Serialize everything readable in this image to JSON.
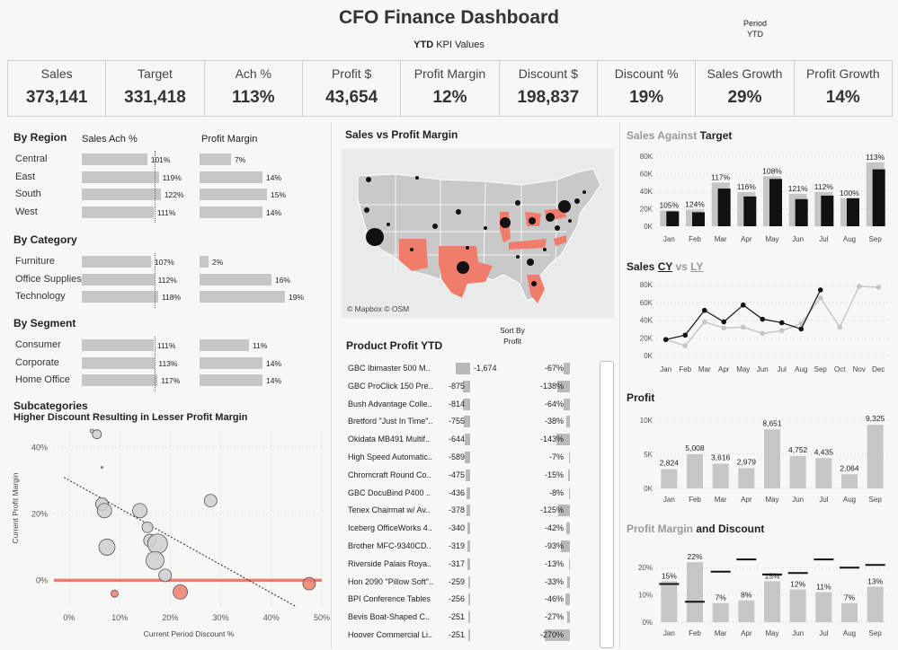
{
  "title": "CFO Finance Dashboard",
  "subtitle_bold": "YTD",
  "subtitle_rest": " KPI Values",
  "period": {
    "label": "Period",
    "value": "YTD"
  },
  "kpis": [
    {
      "label": "Sales",
      "value": "373,141"
    },
    {
      "label": "Target",
      "value": "331,418"
    },
    {
      "label": "Ach %",
      "value": "113%"
    },
    {
      "label": "Profit $",
      "value": "43,654"
    },
    {
      "label": "Profit Margin",
      "value": "12%"
    },
    {
      "label": "Discount $",
      "value": "198,837"
    },
    {
      "label": "Discount %",
      "value": "19%"
    },
    {
      "label": "Sales Growth",
      "value": "29%"
    },
    {
      "label": "Profit Growth",
      "value": "14%"
    }
  ],
  "breakdown": {
    "col_sales": "Sales Ach %",
    "col_margin": "Profit Margin",
    "groups": [
      {
        "title": "By Region",
        "rows": [
          {
            "name": "Central",
            "ach": 101,
            "ach_label": "101%",
            "margin": 7,
            "margin_label": "7%"
          },
          {
            "name": "East",
            "ach": 119,
            "ach_label": "119%",
            "margin": 14,
            "margin_label": "14%"
          },
          {
            "name": "South",
            "ach": 122,
            "ach_label": "122%",
            "margin": 15,
            "margin_label": "15%"
          },
          {
            "name": "West",
            "ach": 111,
            "ach_label": "111%",
            "margin": 14,
            "margin_label": "14%"
          }
        ]
      },
      {
        "title": "By Category",
        "rows": [
          {
            "name": "Furniture",
            "ach": 107,
            "ach_label": "107%",
            "margin": 2,
            "margin_label": "2%"
          },
          {
            "name": "Office Supplies",
            "ach": 112,
            "ach_label": "112%",
            "margin": 16,
            "margin_label": "16%"
          },
          {
            "name": "Technology",
            "ach": 118,
            "ach_label": "118%",
            "margin": 19,
            "margin_label": "19%"
          }
        ]
      },
      {
        "title": "By Segment",
        "rows": [
          {
            "name": "Consumer",
            "ach": 111,
            "ach_label": "111%",
            "margin": 11,
            "margin_label": "11%"
          },
          {
            "name": "Corporate",
            "ach": 113,
            "ach_label": "113%",
            "margin": 14,
            "margin_label": "14%"
          },
          {
            "name": "Home Office",
            "ach": 117,
            "ach_label": "117%",
            "margin": 14,
            "margin_label": "14%"
          }
        ]
      }
    ]
  },
  "scatter": {
    "title": "Subcategories",
    "subtitle": "Higher Discount Resulting in Lesser Profit Margin",
    "xlabel": "Current Period Discount %",
    "ylabel": "Current Profit Margin",
    "xticks": [
      "0%",
      "10%",
      "20%",
      "30%",
      "40%",
      "50%"
    ],
    "yticks": [
      "40%",
      "20%",
      "0%"
    ]
  },
  "map": {
    "title": "Sales vs Profit Margin",
    "credit": "© Mapbox © OSM"
  },
  "product_profit": {
    "title": "Product Profit YTD",
    "sort_label": "Sort By",
    "sort_value": "Profit",
    "rows": [
      {
        "name": "GBC Ibimaster 500 M..",
        "profit": -1674,
        "profit_label": "-1,674",
        "margin": -67,
        "margin_label": "-67%"
      },
      {
        "name": "GBC ProClick 150 Pre..",
        "profit": -875,
        "profit_label": "-875",
        "margin": -138,
        "margin_label": "-138%"
      },
      {
        "name": "Bush Advantage Colle..",
        "profit": -814,
        "profit_label": "-814",
        "margin": -64,
        "margin_label": "-64%"
      },
      {
        "name": "Bretford \"Just In Time\"..",
        "profit": -755,
        "profit_label": "-755",
        "margin": -38,
        "margin_label": "-38%"
      },
      {
        "name": "Okidata MB491 Multif..",
        "profit": -644,
        "profit_label": "-644",
        "margin": -143,
        "margin_label": "-143%"
      },
      {
        "name": "High Speed Automatic..",
        "profit": -589,
        "profit_label": "-589",
        "margin": -7,
        "margin_label": "-7%"
      },
      {
        "name": "Chromcraft Round Co..",
        "profit": -475,
        "profit_label": "-475",
        "margin": -15,
        "margin_label": "-15%"
      },
      {
        "name": "GBC DocuBind P400 ..",
        "profit": -436,
        "profit_label": "-436",
        "margin": -8,
        "margin_label": "-8%"
      },
      {
        "name": "Tenex Chairmat w/ Av..",
        "profit": -378,
        "profit_label": "-378",
        "margin": -125,
        "margin_label": "-125%"
      },
      {
        "name": "Iceberg OfficeWorks 4..",
        "profit": -340,
        "profit_label": "-340",
        "margin": -42,
        "margin_label": "-42%"
      },
      {
        "name": "Brother MFC-9340CD..",
        "profit": -319,
        "profit_label": "-319",
        "margin": -93,
        "margin_label": "-93%"
      },
      {
        "name": "Riverside Palais Roya..",
        "profit": -317,
        "profit_label": "-317",
        "margin": -13,
        "margin_label": "-13%"
      },
      {
        "name": "Hon 2090 \"Pillow Soft\"..",
        "profit": -259,
        "profit_label": "-259",
        "margin": -33,
        "margin_label": "-33%"
      },
      {
        "name": "BPI Conference Tables",
        "profit": -256,
        "profit_label": "-256",
        "margin": -46,
        "margin_label": "-46%"
      },
      {
        "name": "Bevis Boat-Shaped C..",
        "profit": -251,
        "profit_label": "-251",
        "margin": -27,
        "margin_label": "-27%"
      },
      {
        "name": "Hoover Commercial Li..",
        "profit": -251,
        "profit_label": "-251",
        "margin": -270,
        "margin_label": "-270%"
      }
    ]
  },
  "right_titles": {
    "sat_grey": "Sales Against ",
    "sat_bold": "Target",
    "cy_prefix": "Sales ",
    "cy": "CY",
    "vs": " vs ",
    "ly": "LY",
    "profit": "Profit",
    "pmd_grey": "Profit Margin",
    "pmd_bold": " and Discount"
  },
  "colors": {
    "accent": "#f07d6c",
    "bar": "#c6c6c6",
    "dark": "#111111"
  },
  "chart_data": [
    {
      "type": "bar",
      "title": "Sales Against Target",
      "categories": [
        "Jan",
        "Feb",
        "Mar",
        "Apr",
        "May",
        "Jun",
        "Jul",
        "Aug",
        "Sep"
      ],
      "series": [
        {
          "name": "Sales",
          "values": [
            18000,
            19000,
            50000,
            39000,
            57000,
            37000,
            39000,
            32000,
            73000
          ]
        },
        {
          "name": "Target",
          "values": [
            17000,
            16000,
            43000,
            34000,
            54000,
            31000,
            35000,
            32000,
            65000
          ]
        }
      ],
      "labels": [
        "105%",
        "124%",
        "117%",
        "116%",
        "108%",
        "121%",
        "112%",
        "100%",
        "113%"
      ],
      "yticks": [
        "80K",
        "60K",
        "40K",
        "20K",
        "0K"
      ],
      "ylim": [
        0,
        80000
      ]
    },
    {
      "type": "line",
      "title": "Sales CY vs LY",
      "categories": [
        "Jan",
        "Feb",
        "Mar",
        "Apr",
        "May",
        "Jun",
        "Jul",
        "Aug",
        "Sep",
        "Oct",
        "Nov",
        "Dec"
      ],
      "series": [
        {
          "name": "CY",
          "values": [
            18000,
            23000,
            51000,
            38000,
            57000,
            41000,
            37000,
            30000,
            74000,
            null,
            null,
            null
          ]
        },
        {
          "name": "LY",
          "values": [
            18000,
            11000,
            38000,
            31000,
            32000,
            25000,
            28000,
            36000,
            65000,
            32000,
            78000,
            77000
          ]
        }
      ],
      "yticks": [
        "80K",
        "60K",
        "40K",
        "20K",
        "0K"
      ],
      "ylim": [
        0,
        80000
      ]
    },
    {
      "type": "bar",
      "title": "Profit",
      "categories": [
        "Jan",
        "Feb",
        "Mar",
        "Apr",
        "May",
        "Jun",
        "Jul",
        "Aug",
        "Sep"
      ],
      "values": [
        2824,
        5008,
        3616,
        2979,
        8651,
        4752,
        4435,
        2064,
        9325
      ],
      "labels": [
        "2,824",
        "5,008",
        "3,616",
        "2,979",
        "8,651",
        "4,752",
        "4,435",
        "2,064",
        "9,325"
      ],
      "yticks": [
        "10K",
        "5K",
        "0K"
      ],
      "ylim": [
        0,
        10000
      ]
    },
    {
      "type": "bar",
      "title": "Profit Margin and Discount",
      "categories": [
        "Jan",
        "Feb",
        "Mar",
        "Apr",
        "May",
        "Jun",
        "Jul",
        "Aug",
        "Sep"
      ],
      "series": [
        {
          "name": "Profit Margin",
          "values": [
            15,
            22,
            7,
            8,
            15,
            12,
            11,
            7,
            13
          ]
        },
        {
          "name": "Discount",
          "values": [
            14,
            7.5,
            18.5,
            23,
            17.5,
            18,
            23,
            20,
            21
          ]
        }
      ],
      "labels": [
        "15%",
        "22%",
        "7%",
        "8%",
        "15%",
        "12%",
        "11%",
        "7%",
        "13%"
      ],
      "yticks": [
        "20%",
        "10%",
        "0%"
      ],
      "ylim": [
        0,
        26
      ]
    },
    {
      "type": "scatter",
      "title": "Subcategories",
      "xlabel": "Current Period Discount %",
      "ylabel": "Current Profit Margin",
      "xlim": [
        -3,
        50
      ],
      "ylim": [
        -8,
        45
      ],
      "points": [
        {
          "x": 4.5,
          "y": 45,
          "s": 2,
          "neg": false
        },
        {
          "x": 5.5,
          "y": 44,
          "s": 5,
          "neg": false
        },
        {
          "x": 6.5,
          "y": 34,
          "s": 1,
          "neg": false
        },
        {
          "x": 6.5,
          "y": 23,
          "s": 7,
          "neg": false
        },
        {
          "x": 7,
          "y": 21,
          "s": 8,
          "neg": false
        },
        {
          "x": 7.5,
          "y": 10,
          "s": 9,
          "neg": false
        },
        {
          "x": 14,
          "y": 21,
          "s": 8,
          "neg": false
        },
        {
          "x": 15.5,
          "y": 16,
          "s": 6,
          "neg": false
        },
        {
          "x": 16,
          "y": 12,
          "s": 7,
          "neg": false
        },
        {
          "x": 17.5,
          "y": 11,
          "s": 11,
          "neg": false
        },
        {
          "x": 17,
          "y": 6,
          "s": 10,
          "neg": false
        },
        {
          "x": 19,
          "y": 1.5,
          "s": 7,
          "neg": false
        },
        {
          "x": 28,
          "y": 24,
          "s": 7,
          "neg": false
        },
        {
          "x": 9,
          "y": -4,
          "s": 4,
          "neg": true
        },
        {
          "x": 22,
          "y": -3.5,
          "s": 8,
          "neg": true
        },
        {
          "x": 47.5,
          "y": -1,
          "s": 7,
          "neg": true
        }
      ]
    }
  ]
}
